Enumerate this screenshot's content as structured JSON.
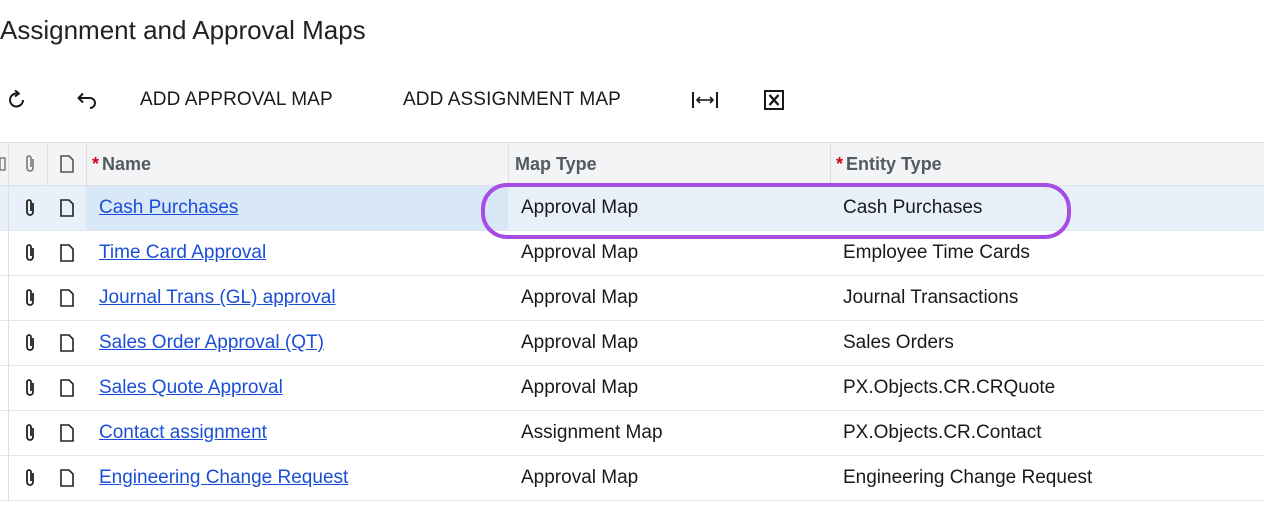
{
  "page": {
    "title": "Assignment and Approval Maps"
  },
  "toolbar": {
    "refresh_icon": "refresh-icon",
    "undo_icon": "undo-icon",
    "add_approval_map_label": "ADD APPROVAL MAP",
    "add_assignment_map_label": "ADD ASSIGNMENT MAP",
    "fit_columns_icon": "fit-columns-icon",
    "export_excel_icon": "excel-export-icon"
  },
  "grid": {
    "headers": {
      "name": "Name",
      "map_type": "Map Type",
      "entity_type": "Entity Type",
      "required_mark": "*"
    },
    "rows": [
      {
        "name": "Cash Purchases",
        "map_type": "Approval Map",
        "entity_type": "Cash Purchases"
      },
      {
        "name": "Time Card Approval",
        "map_type": "Approval Map",
        "entity_type": "Employee Time Cards"
      },
      {
        "name": "Journal Trans (GL) approval",
        "map_type": "Approval Map",
        "entity_type": "Journal Transactions"
      },
      {
        "name": "Sales Order Approval (QT)",
        "map_type": "Approval Map",
        "entity_type": "Sales Orders"
      },
      {
        "name": "Sales Quote Approval",
        "map_type": "Approval Map",
        "entity_type": "PX.Objects.CR.CRQuote"
      },
      {
        "name": "Contact assignment",
        "map_type": "Assignment Map",
        "entity_type": "PX.Objects.CR.Contact"
      },
      {
        "name": "Engineering Change Request",
        "map_type": "Approval Map",
        "entity_type": "Engineering Change Request"
      }
    ]
  },
  "colors": {
    "highlight": "#a64de3",
    "link": "#1a4fd6",
    "required": "#d0021b",
    "selected_row": "#e8f1fa"
  }
}
